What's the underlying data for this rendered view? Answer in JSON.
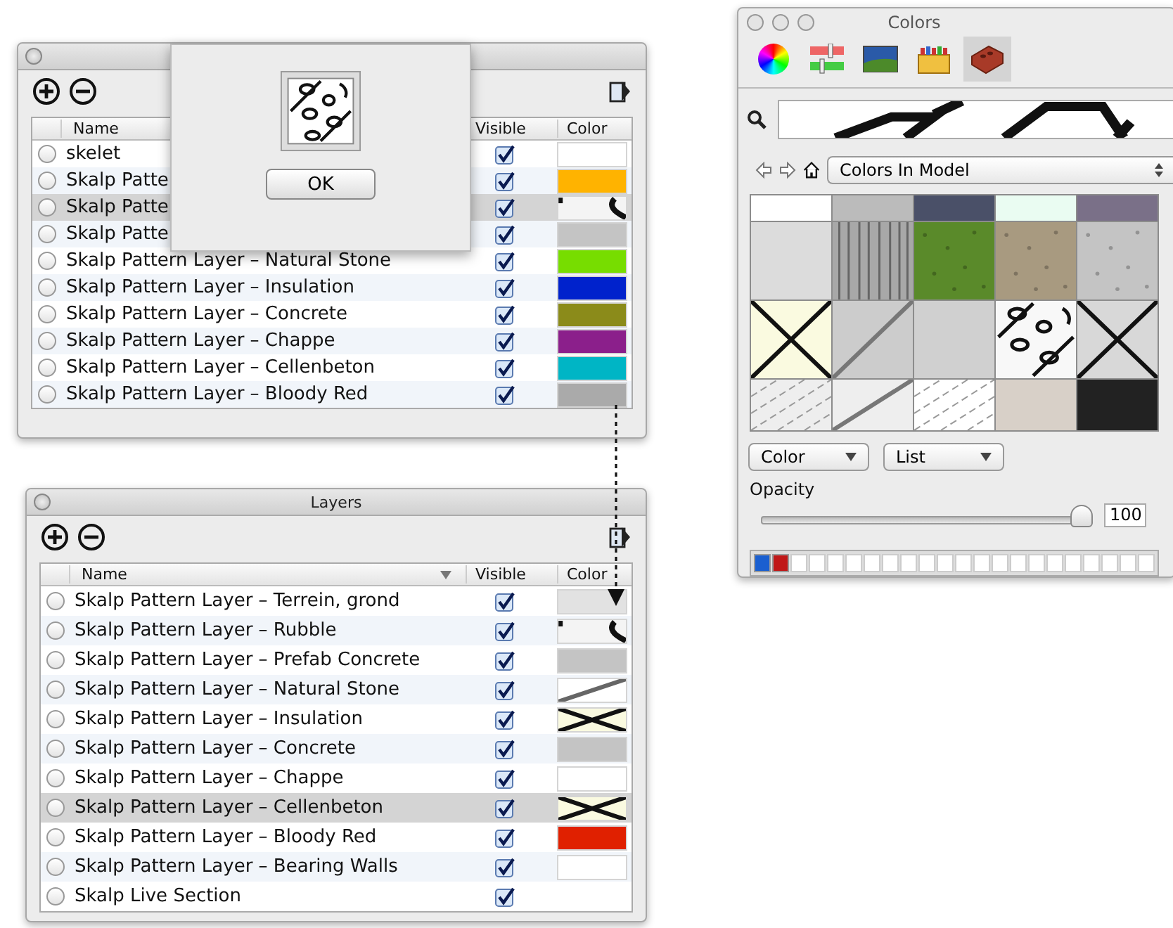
{
  "layers_windows": [
    {
      "columns": [
        "Name",
        "Visible",
        "Color"
      ],
      "dialog": {
        "button": "OK"
      },
      "rows": [
        {
          "name": "skelet",
          "visible": true,
          "selected": false,
          "swatch": {
            "kind": "solid",
            "color": "#ffffff"
          }
        },
        {
          "name": "Skalp Patte",
          "visible": true,
          "selected": false,
          "swatch": {
            "kind": "solid",
            "color": "#ffb300"
          }
        },
        {
          "name": "Skalp Patte",
          "visible": true,
          "selected": true,
          "swatch": {
            "kind": "rubble",
            "color": "#f4f4f4"
          }
        },
        {
          "name": "Skalp Patte",
          "visible": true,
          "selected": false,
          "swatch": {
            "kind": "solid",
            "color": "#c4c4c4"
          }
        },
        {
          "name": "Skalp Pattern Layer – Natural Stone",
          "visible": true,
          "selected": false,
          "swatch": {
            "kind": "solid",
            "color": "#77dd00"
          }
        },
        {
          "name": "Skalp Pattern Layer – Insulation",
          "visible": true,
          "selected": false,
          "swatch": {
            "kind": "solid",
            "color": "#0022cc"
          }
        },
        {
          "name": "Skalp Pattern Layer – Concrete",
          "visible": true,
          "selected": false,
          "swatch": {
            "kind": "solid",
            "color": "#8b8b1a"
          }
        },
        {
          "name": "Skalp Pattern Layer – Chappe",
          "visible": true,
          "selected": false,
          "swatch": {
            "kind": "solid",
            "color": "#8b1f8b"
          }
        },
        {
          "name": "Skalp Pattern Layer – Cellenbeton",
          "visible": true,
          "selected": false,
          "swatch": {
            "kind": "solid",
            "color": "#00b5c5"
          }
        },
        {
          "name": "Skalp Pattern Layer – Bloody Red",
          "visible": true,
          "selected": false,
          "swatch": {
            "kind": "solid",
            "color": "#aaaaaa"
          }
        }
      ]
    },
    {
      "title": "Layers",
      "columns": [
        "Name",
        "Visible",
        "Color"
      ],
      "rows": [
        {
          "name": "Skalp Pattern Layer – Terrein, grond",
          "visible": true,
          "selected": false,
          "swatch": {
            "kind": "solid",
            "color": "#e2e2e2"
          }
        },
        {
          "name": "Skalp Pattern Layer – Rubble",
          "visible": true,
          "selected": false,
          "swatch": {
            "kind": "rubble",
            "color": "#f4f4f4"
          }
        },
        {
          "name": "Skalp Pattern Layer – Prefab Concrete",
          "visible": true,
          "selected": false,
          "swatch": {
            "kind": "solid",
            "color": "#c4c4c4"
          }
        },
        {
          "name": "Skalp Pattern Layer – Natural Stone",
          "visible": true,
          "selected": false,
          "swatch": {
            "kind": "diagonal",
            "color": "#ffffff"
          }
        },
        {
          "name": "Skalp Pattern Layer – Insulation",
          "visible": true,
          "selected": false,
          "swatch": {
            "kind": "cross",
            "color": "#fafae0"
          }
        },
        {
          "name": "Skalp Pattern Layer – Concrete",
          "visible": true,
          "selected": false,
          "swatch": {
            "kind": "solid",
            "color": "#c4c4c4"
          }
        },
        {
          "name": "Skalp Pattern Layer – Chappe",
          "visible": true,
          "selected": false,
          "swatch": {
            "kind": "solid",
            "color": "#ffffff"
          }
        },
        {
          "name": "Skalp Pattern Layer – Cellenbeton",
          "visible": true,
          "selected": true,
          "swatch": {
            "kind": "cross",
            "color": "#fafae0"
          }
        },
        {
          "name": "Skalp Pattern Layer – Bloody Red",
          "visible": true,
          "selected": false,
          "swatch": {
            "kind": "solid",
            "color": "#e02000"
          }
        },
        {
          "name": "Skalp Pattern Layer – Bearing Walls",
          "visible": true,
          "selected": false,
          "swatch": {
            "kind": "solid",
            "color": "#ffffff"
          }
        },
        {
          "name": "Skalp Live Section",
          "visible": true,
          "selected": false
        }
      ]
    }
  ],
  "colors_window": {
    "title": "Colors",
    "tabs": [
      {
        "kind": "wheel",
        "selected": false
      },
      {
        "kind": "sliders",
        "selected": false
      },
      {
        "kind": "image",
        "selected": false
      },
      {
        "kind": "crayons",
        "selected": false
      },
      {
        "kind": "brick",
        "selected": true
      }
    ],
    "location": "Colors In Model",
    "swatches": [
      {
        "kind": "solid",
        "color": "#ffffff"
      },
      {
        "kind": "solid",
        "color": "#bbbbbb"
      },
      {
        "kind": "solid",
        "color": "#4a5068"
      },
      {
        "kind": "solid",
        "color": "#eafcf2"
      },
      {
        "kind": "solid",
        "color": "#7a7088"
      },
      {
        "kind": "solid",
        "color": "#dcdcdc"
      },
      {
        "kind": "stripes",
        "color": "#a8a8a8"
      },
      {
        "kind": "speckle",
        "color": "#5a8a2a"
      },
      {
        "kind": "speckle",
        "color": "#a89a80"
      },
      {
        "kind": "speckle",
        "color": "#c4c4c4"
      },
      {
        "kind": "cross",
        "color": "#fafae0"
      },
      {
        "kind": "diagonal",
        "color": "#cccccc"
      },
      {
        "kind": "solid",
        "color": "#d0d0d0"
      },
      {
        "kind": "rubble",
        "color": "#f8f8f8"
      },
      {
        "kind": "cross",
        "color": "#d8d8d8"
      },
      {
        "kind": "hatch",
        "color": "#eeeeee"
      },
      {
        "kind": "diagonal",
        "color": "#eeeeee"
      },
      {
        "kind": "hatch",
        "color": "#ffffff"
      },
      {
        "kind": "solid",
        "color": "#d8d0c8"
      },
      {
        "kind": "solid",
        "color": "#222222"
      }
    ],
    "menus": [
      "Color",
      "List"
    ],
    "opacity": {
      "label": "Opacity",
      "level": 1,
      "value": "100"
    },
    "tray": [
      {
        "color": "#1a5fd0"
      },
      {
        "color": "#c01818"
      },
      {
        "color": "#ffffff"
      },
      {
        "color": "#ffffff"
      },
      {
        "color": "#ffffff"
      },
      {
        "color": "#ffffff"
      },
      {
        "color": "#ffffff"
      },
      {
        "color": "#ffffff"
      },
      {
        "color": "#ffffff"
      },
      {
        "color": "#ffffff"
      },
      {
        "color": "#ffffff"
      },
      {
        "color": "#ffffff"
      },
      {
        "color": "#ffffff"
      },
      {
        "color": "#ffffff"
      },
      {
        "color": "#ffffff"
      },
      {
        "color": "#ffffff"
      },
      {
        "color": "#ffffff"
      },
      {
        "color": "#ffffff"
      },
      {
        "color": "#ffffff"
      },
      {
        "color": "#ffffff"
      },
      {
        "color": "#ffffff"
      },
      {
        "color": "#ffffff"
      }
    ]
  }
}
